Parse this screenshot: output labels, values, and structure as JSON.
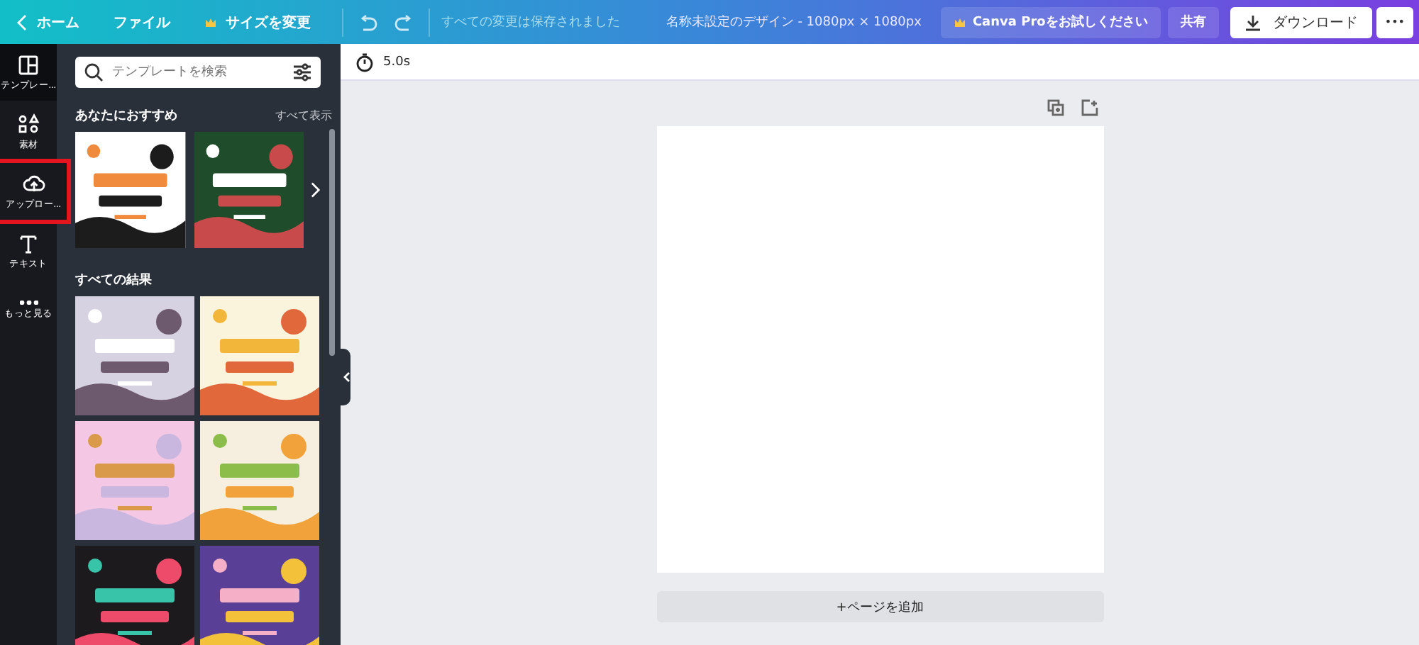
{
  "topbar": {
    "back": "ホーム",
    "menus": [
      "ファイル",
      "サイズを変更"
    ],
    "save_status": "すべての変更は保存されました",
    "title": "名称未設定のデザイン - 1080px × 1080px",
    "pro": "Canva Proをお試しください",
    "share": "共有",
    "download": "ダウンロード",
    "more": "•••"
  },
  "rail": [
    {
      "kind": "templates",
      "label": "テンプレー...",
      "selected": true
    },
    {
      "kind": "elements",
      "label": "素材",
      "selected": false
    },
    {
      "kind": "upload",
      "label": "アップロー...",
      "selected": false,
      "highlighted": true
    },
    {
      "kind": "text",
      "label": "テキスト",
      "selected": false
    },
    {
      "kind": "more",
      "label": "もっと見る",
      "selected": false
    }
  ],
  "panel": {
    "search": {
      "placeholder": "テンプレートを検索"
    },
    "recommended": {
      "title": "あなたにおすすめ",
      "see_all": "すべて表示"
    },
    "results": {
      "title": "すべての結果"
    }
  },
  "editor": {
    "duration": "5.0s",
    "add_page": "+ページを追加"
  }
}
